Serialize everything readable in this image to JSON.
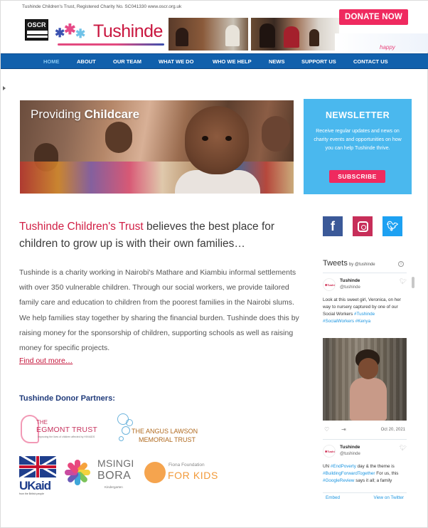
{
  "header": {
    "top_strip": "Tushinde Children's Trust, Registered Charity No. SC041330  www.oscr.org.uk",
    "oscr_label": "OSCR",
    "logo_text": "Tushinde",
    "donate_label": "DONATE NOW",
    "happy_text": "happy"
  },
  "nav": {
    "items": [
      {
        "label": "HOME",
        "active": true
      },
      {
        "label": "ABOUT"
      },
      {
        "label": "OUR TEAM"
      },
      {
        "label": "WHAT WE DO"
      },
      {
        "label": "WHO WE HELP"
      },
      {
        "label": "NEWS"
      },
      {
        "label": "SUPPORT US"
      },
      {
        "label": "CONTACT US"
      }
    ]
  },
  "banner": {
    "text_light": "Providing ",
    "text_bold": "Childcare"
  },
  "newsletter": {
    "title": "NEWSLETTER",
    "body": "Receive regular updates and news on charity events and opportunities on how you can help Tushinde thrive.",
    "subscribe_label": "SUBSCRIBE"
  },
  "main": {
    "headline_brand": "Tushinde Children's Trust",
    "headline_rest": " believes the best place for children to grow up is with their own families…",
    "body": "Tushinde is a charity working in Nairobi's Mathare and Kiambiu informal settlements with over 350 vulnerable children. Through our social workers, we provide tailored family care and education to children from the poorest families in the Nairobi slums. We help families stay together by sharing the financial burden. Tushinde does this by raising money for the sponsorship of children, supporting schools as well as raising money for specific projects.",
    "find_more": "Find out more…",
    "partners_title": "Tushinde Donor Partners:"
  },
  "partners": {
    "egmont_the": "THE",
    "egmont_name": "EGMONT TRUST",
    "egmont_tag": "Improving the lives of children affected by HIV/AIDS",
    "angus_line1": "THE ANGUS LAWSON",
    "angus_line2": "MEMORIAL TRUST",
    "ukaid_text": "UKaid",
    "ukaid_sub": "from the British people",
    "msingi_line1": "MSINGI",
    "msingi_line2": "BORA",
    "msingi_sub": "Kindergarten",
    "fiona_line1": "Fiona Foundation",
    "fiona_line2": "FOR KIDS"
  },
  "social": {
    "facebook_icon": "facebook-icon",
    "instagram_icon": "instagram-icon",
    "twitter_icon": "twitter-icon"
  },
  "twitter_widget": {
    "title": "Tweets",
    "by": "by @tushinde",
    "tweets": [
      {
        "name": "Tushinde",
        "handle": "@tushinde",
        "text_plain": "Look at this sweet girl, Veronica, on her way to nursery captured by one of our Social Workers ",
        "tags": "#Tushinde #SocialWorkers #Kenya",
        "date": "Oct 20, 2021"
      },
      {
        "name": "Tushinde",
        "handle": "@tushinde",
        "text_a": "UN ",
        "tag_a": "#EndPoverty",
        "text_b": " day & the theme is ",
        "tag_b": "#BuildingForwardTogether",
        "text_c": " For us, this ",
        "tag_c": "#GoogleReview",
        "text_d": " says it all; a family"
      }
    ],
    "embed": "Embed",
    "view_on_twitter": "View on Twitter"
  },
  "colors": {
    "brand_red": "#d11f45",
    "nav_blue": "#1160ac",
    "newsletter_blue": "#4ab8ee",
    "button_pink": "#ef2a5f"
  }
}
